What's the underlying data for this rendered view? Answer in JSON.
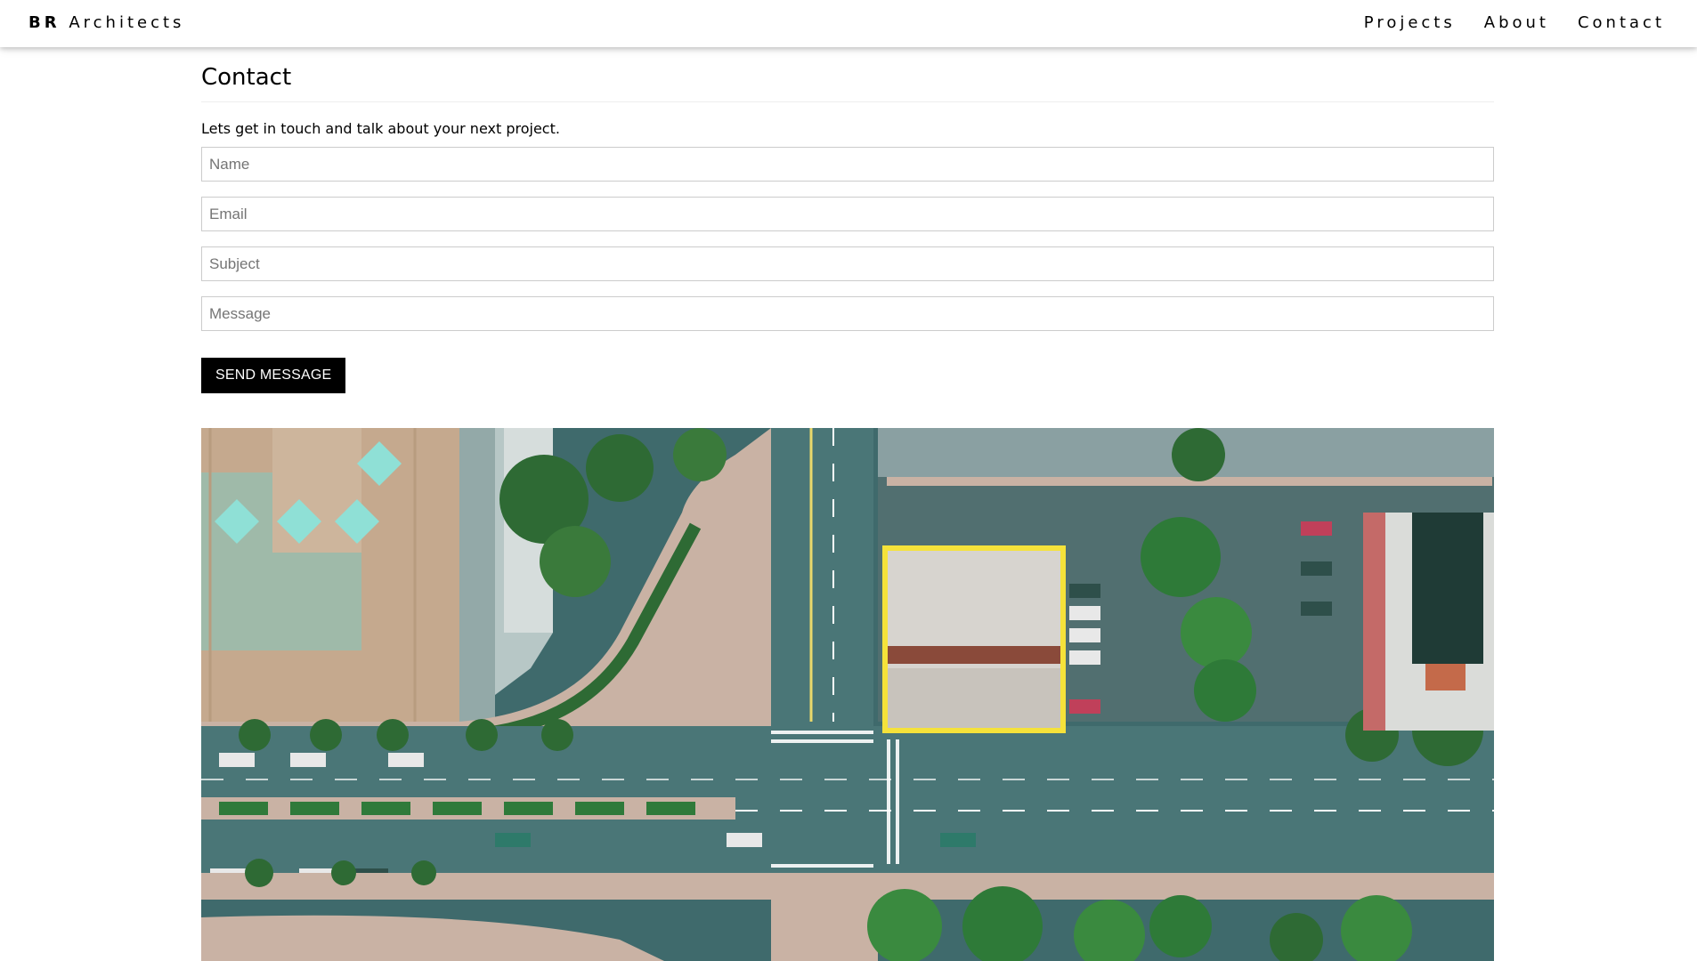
{
  "navbar": {
    "brand_bold": "BR",
    "brand_rest": "Architects",
    "links": [
      "Projects",
      "About",
      "Contact"
    ]
  },
  "contact": {
    "title": "Contact",
    "intro": "Lets get in touch and talk about your next project.",
    "name_placeholder": "Name",
    "email_placeholder": "Email",
    "subject_placeholder": "Subject",
    "message_placeholder": "Message",
    "send_label": "SEND MESSAGE"
  },
  "image": {
    "subject": "aerial-city-intersection",
    "colors": {
      "road": "#3f6a6c",
      "sidewalk": "#c9b2a4",
      "trees": "#2e6a34",
      "highlight": "#f5e23a"
    }
  }
}
